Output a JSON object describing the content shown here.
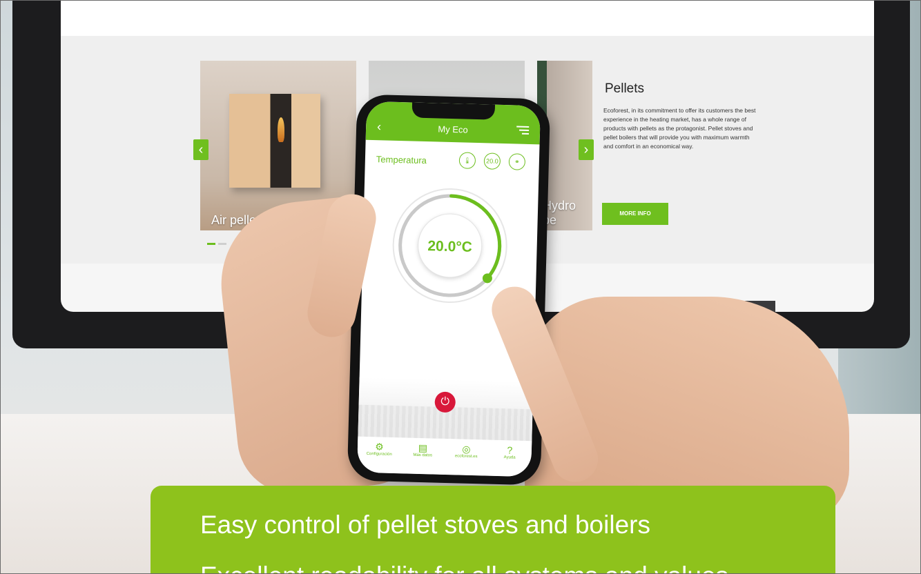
{
  "website": {
    "card1_label": "Air pellet stoves",
    "card3_label": "Hydro pe",
    "prev_arrow": "‹",
    "next_arrow": "›",
    "info_title": "Pellets",
    "info_text": "Ecoforest, in its commitment to offer its customers the best experience in the heating market, has a whole range of products with pellets as the protagonist. Pellet stoves and pellet boilers that will provide you with maximum warmth and comfort in an economical way.",
    "more_button": "MORE INFO",
    "slide_indicator": {
      "total": 2,
      "active": 1
    }
  },
  "app": {
    "back": "‹",
    "title": "My Eco",
    "section_label": "Temperatura",
    "mode_icons": [
      "thermometer-icon",
      "range-icon",
      "link-icon"
    ],
    "mode_icon_2_text": "20.0",
    "dial_value": "20.0°C",
    "dial_fraction": 0.36,
    "power_symbol": "⏻",
    "nav": [
      {
        "icon": "gear-icon",
        "glyph": "⚙",
        "label": "Configuración"
      },
      {
        "icon": "document-icon",
        "glyph": "▤",
        "label": "Más datos"
      },
      {
        "icon": "globe-icon",
        "glyph": "◎",
        "label": "ecoforest.es"
      },
      {
        "icon": "help-icon",
        "glyph": "?",
        "label": "Ayuda"
      }
    ]
  },
  "banner": {
    "line1": "Easy control of pellet stoves and boilers",
    "line2": "Excellent readability for all systems and values"
  },
  "colors": {
    "accent": "#6cbe1e",
    "banner": "#8ec21c",
    "power": "#d8183a"
  }
}
